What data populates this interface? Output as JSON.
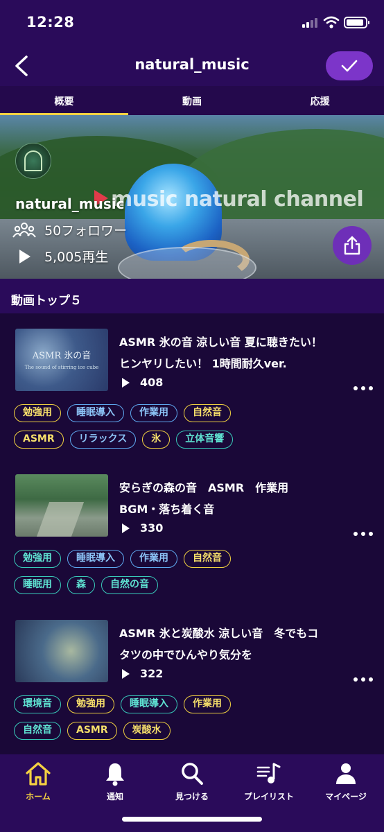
{
  "status_bar": {
    "time": "12:28"
  },
  "header": {
    "title": "natural_music"
  },
  "tabs": [
    {
      "label": "概要"
    },
    {
      "label": "動画"
    },
    {
      "label": "応援"
    }
  ],
  "channel": {
    "name": "natural_music",
    "banner_text": "music natural channel",
    "followers": "50フォロワー",
    "plays": "5,005再生"
  },
  "section": {
    "title": "動画トップ５"
  },
  "videos": [
    {
      "title_line1": "ASMR 氷の音 涼しい音 夏に聴きたい！",
      "title_line2": "ヒンヤリしたい！ 1時間耐久ver.",
      "plays": "408",
      "thumb_title": "ASMR 氷の音",
      "thumb_sub": "The sound of stirring ice cube",
      "tags_row1": [
        {
          "label": "勉強用",
          "color": "yellow"
        },
        {
          "label": "睡眠導入",
          "color": "blue"
        },
        {
          "label": "作業用",
          "color": "blue"
        },
        {
          "label": "自然音",
          "color": "yellow"
        }
      ],
      "tags_row2": [
        {
          "label": "ASMR",
          "color": "yellow"
        },
        {
          "label": "リラックス",
          "color": "blue"
        },
        {
          "label": "氷",
          "color": "yellow"
        },
        {
          "label": "立体音響",
          "color": "teal"
        }
      ]
    },
    {
      "title_line1": "安らぎの森の音　ASMR　作業用",
      "title_line2": "BGM・落ち着く音",
      "plays": "330",
      "tags_row1": [
        {
          "label": "勉強用",
          "color": "teal"
        },
        {
          "label": "睡眠導入",
          "color": "blue"
        },
        {
          "label": "作業用",
          "color": "blue"
        },
        {
          "label": "自然音",
          "color": "yellow"
        }
      ],
      "tags_row2": [
        {
          "label": "睡眠用",
          "color": "teal"
        },
        {
          "label": "森",
          "color": "teal"
        },
        {
          "label": "自然の音",
          "color": "teal"
        }
      ]
    },
    {
      "title_line1": "ASMR 氷と炭酸水 涼しい音　冬でもコ",
      "title_line2": "タツの中でひんやり気分を",
      "plays": "322",
      "tags_row1": [
        {
          "label": "環境音",
          "color": "teal"
        },
        {
          "label": "勉強用",
          "color": "yellow"
        },
        {
          "label": "睡眠導入",
          "color": "teal"
        },
        {
          "label": "作業用",
          "color": "yellow"
        }
      ],
      "tags_row2": [
        {
          "label": "自然音",
          "color": "teal"
        },
        {
          "label": "ASMR",
          "color": "yellow"
        },
        {
          "label": "炭酸水",
          "color": "yellow"
        }
      ]
    }
  ],
  "bottom_nav": [
    {
      "label": "ホーム",
      "icon": "home-icon"
    },
    {
      "label": "通知",
      "icon": "bell-icon"
    },
    {
      "label": "見つける",
      "icon": "search-icon"
    },
    {
      "label": "プレイリスト",
      "icon": "playlist-icon"
    },
    {
      "label": "マイページ",
      "icon": "person-icon"
    }
  ],
  "colors": {
    "background": "#1a0838",
    "bar": "#2a0b5a",
    "accent": "#f5d142",
    "purple_button": "#7c35c9"
  }
}
